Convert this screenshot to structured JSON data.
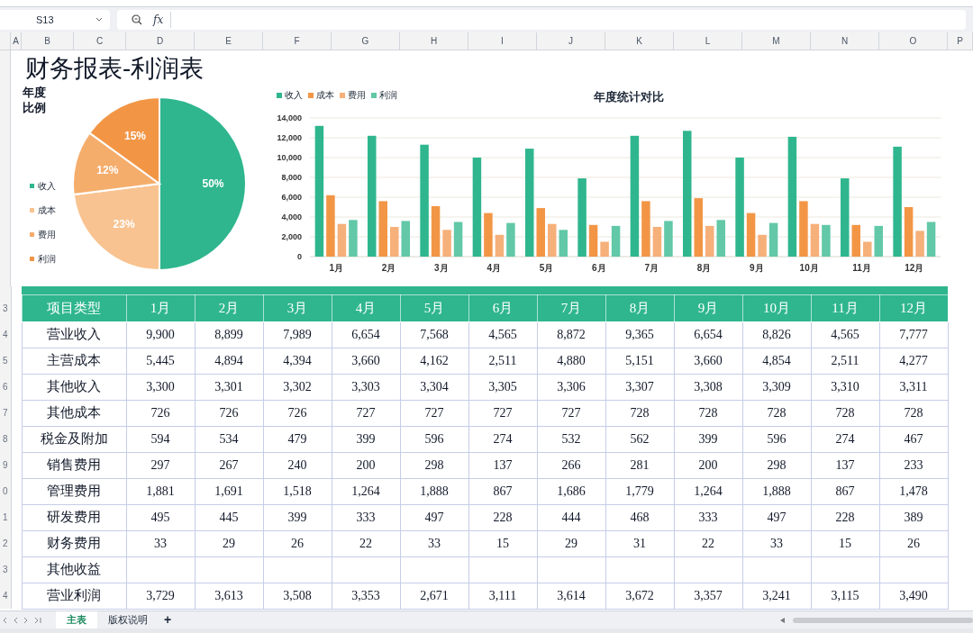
{
  "toolbar": {
    "name_box": "S13",
    "formula_label": "fx"
  },
  "column_headers": [
    "A",
    "B",
    "C",
    "D",
    "E",
    "F",
    "G",
    "H",
    "I",
    "J",
    "K",
    "L",
    "M",
    "N",
    "O",
    "P"
  ],
  "title": "财务报表-利润表",
  "pie": {
    "slice_colors": [
      {
        "color": "#2fb68e"
      },
      {
        "color": "#f8c391"
      },
      {
        "color": "#f5ad6c"
      },
      {
        "color": "#f29646"
      }
    ],
    "chart_data": {
      "type": "pie",
      "title": "年度比例",
      "categories": [
        "收入",
        "成本",
        "费用",
        "利润"
      ],
      "series": [
        {
          "values": [
            50,
            23,
            12,
            15
          ]
        }
      ],
      "value_labels": [
        "50%",
        "23%",
        "12%",
        "15%"
      ],
      "legend": true
    }
  },
  "bar": {
    "chart_data": {
      "type": "bar",
      "title": "年度统计对比",
      "categories": [
        "1月",
        "2月",
        "3月",
        "4月",
        "5月",
        "6月",
        "7月",
        "8月",
        "9月",
        "10月",
        "11月",
        "12月"
      ],
      "series": [
        {
          "name": "收入",
          "color": "#2fb68e",
          "values": [
            13200,
            12200,
            11300,
            10000,
            10900,
            7900,
            12200,
            12700,
            10000,
            12100,
            7900,
            11100
          ]
        },
        {
          "name": "成本",
          "color": "#f29646",
          "values": [
            6200,
            5600,
            5100,
            4400,
            4900,
            3200,
            5600,
            5900,
            4400,
            5600,
            3200,
            5000
          ]
        },
        {
          "name": "费用",
          "color": "#f6b07a",
          "values": [
            3300,
            3000,
            2700,
            2200,
            3300,
            1500,
            3000,
            3100,
            2200,
            3300,
            1500,
            2600
          ]
        },
        {
          "name": "利润",
          "color": "#62c8a8",
          "values": [
            3700,
            3600,
            3500,
            3400,
            2700,
            3100,
            3600,
            3700,
            3400,
            3200,
            3100,
            3500
          ]
        }
      ],
      "legend": true,
      "grid": true,
      "ylim": [
        0,
        14000
      ],
      "yticks": [
        {
          "value": 0,
          "label": "0"
        },
        {
          "value": 2000,
          "label": "2,000"
        },
        {
          "value": 4000,
          "label": "4,000"
        },
        {
          "value": 6000,
          "label": "6,000"
        },
        {
          "value": 8000,
          "label": "8,000"
        },
        {
          "value": 10000,
          "label": "10,000"
        },
        {
          "value": 12000,
          "label": "12,000"
        },
        {
          "value": 14000,
          "label": "14,000"
        }
      ]
    }
  },
  "table": {
    "header_row_number": "3",
    "columns": [
      "项目类型",
      "1月",
      "2月",
      "3月",
      "4月",
      "5月",
      "6月",
      "7月",
      "8月",
      "9月",
      "10月",
      "11月",
      "12月"
    ],
    "rows": [
      {
        "row_number": "4",
        "cells": [
          "营业收入",
          "9,900",
          "8,899",
          "7,989",
          "6,654",
          "7,568",
          "4,565",
          "8,872",
          "9,365",
          "6,654",
          "8,826",
          "4,565",
          "7,777"
        ]
      },
      {
        "row_number": "5",
        "cells": [
          "主营成本",
          "5,445",
          "4,894",
          "4,394",
          "3,660",
          "4,162",
          "2,511",
          "4,880",
          "5,151",
          "3,660",
          "4,854",
          "2,511",
          "4,277"
        ]
      },
      {
        "row_number": "6",
        "cells": [
          "其他收入",
          "3,300",
          "3,301",
          "3,302",
          "3,303",
          "3,304",
          "3,305",
          "3,306",
          "3,307",
          "3,308",
          "3,309",
          "3,310",
          "3,311"
        ]
      },
      {
        "row_number": "7",
        "cells": [
          "其他成本",
          "726",
          "726",
          "726",
          "727",
          "727",
          "727",
          "727",
          "728",
          "728",
          "728",
          "728",
          "728"
        ]
      },
      {
        "row_number": "8",
        "cells": [
          "税金及附加",
          "594",
          "534",
          "479",
          "399",
          "596",
          "274",
          "532",
          "562",
          "399",
          "596",
          "274",
          "467"
        ]
      },
      {
        "row_number": "9",
        "cells": [
          "销售费用",
          "297",
          "267",
          "240",
          "200",
          "298",
          "137",
          "266",
          "281",
          "200",
          "298",
          "137",
          "233"
        ]
      },
      {
        "row_number": "0",
        "cells": [
          "管理费用",
          "1,881",
          "1,691",
          "1,518",
          "1,264",
          "1,888",
          "867",
          "1,686",
          "1,779",
          "1,264",
          "1,888",
          "867",
          "1,478"
        ]
      },
      {
        "row_number": "1",
        "cells": [
          "研发费用",
          "495",
          "445",
          "399",
          "333",
          "497",
          "228",
          "444",
          "468",
          "333",
          "497",
          "228",
          "389"
        ]
      },
      {
        "row_number": "2",
        "cells": [
          "财务费用",
          "33",
          "29",
          "26",
          "22",
          "33",
          "15",
          "29",
          "31",
          "22",
          "33",
          "15",
          "26"
        ]
      },
      {
        "row_number": "3",
        "cells": [
          "其他收益",
          "",
          "",
          "",
          "",
          "",
          "",
          "",
          "",
          "",
          "",
          "",
          ""
        ]
      },
      {
        "row_number": "4",
        "cells": [
          "营业利润",
          "3,729",
          "3,613",
          "3,508",
          "3,353",
          "2,671",
          "3,111",
          "3,614",
          "3,672",
          "3,357",
          "3,241",
          "3,115",
          "3,490"
        ]
      }
    ]
  },
  "sheet_tabs": [
    {
      "label": "主表",
      "selected": true
    },
    {
      "label": "版权说明",
      "selected": false
    }
  ],
  "add_sheet": "+"
}
